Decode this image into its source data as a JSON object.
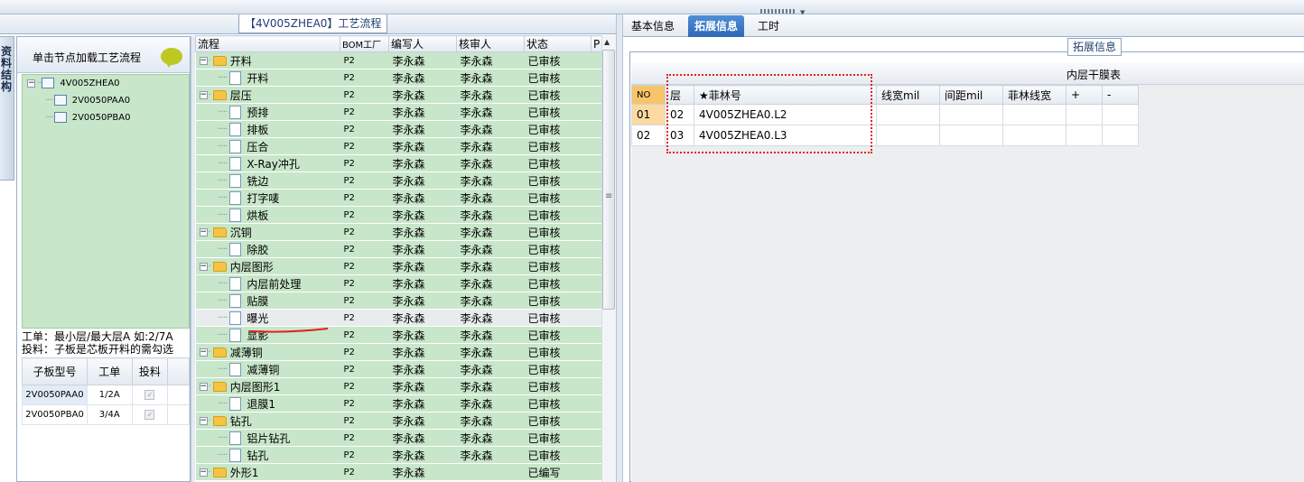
{
  "top": {
    "title": "【4V005ZHEA0】工艺流程"
  },
  "left": {
    "vertical_tab": "资料结构",
    "header_text": "单击节点加载工艺流程",
    "tree": [
      {
        "label": "4V005ZHEA0",
        "level": 0
      },
      {
        "label": "2V0050PAA0",
        "level": 1
      },
      {
        "label": "2V0050PBA0",
        "level": 1
      }
    ],
    "note_line1": "工单：最小层/最大层A 如:2/7A",
    "note_line2": "投料：子板是芯板开料的需勾选",
    "subgrid": {
      "headers": [
        "子板型号",
        "工单",
        "投料"
      ],
      "rows": [
        {
          "model": "2V0050PAA0",
          "order": "1/2A",
          "checked": true
        },
        {
          "model": "2V0050PBA0",
          "order": "3/4A",
          "checked": true
        }
      ]
    }
  },
  "process": {
    "headers": [
      "流程",
      "BOM工厂",
      "编写人",
      "核审人",
      "状态",
      "P"
    ],
    "rows": [
      {
        "name": "开料",
        "type": "folder",
        "bom": "P2",
        "writer": "李永森",
        "auditor": "李永森",
        "status": "已审核"
      },
      {
        "name": "开料",
        "type": "step",
        "bom": "P2",
        "writer": "李永森",
        "auditor": "李永森",
        "status": "已审核"
      },
      {
        "name": "层压",
        "type": "folder",
        "bom": "P2",
        "writer": "李永森",
        "auditor": "李永森",
        "status": "已审核"
      },
      {
        "name": "预排",
        "type": "step",
        "bom": "P2",
        "writer": "李永森",
        "auditor": "李永森",
        "status": "已审核"
      },
      {
        "name": "排板",
        "type": "step",
        "bom": "P2",
        "writer": "李永森",
        "auditor": "李永森",
        "status": "已审核"
      },
      {
        "name": "压合",
        "type": "step",
        "bom": "P2",
        "writer": "李永森",
        "auditor": "李永森",
        "status": "已审核"
      },
      {
        "name": "X-Ray冲孔",
        "type": "step",
        "bom": "P2",
        "writer": "李永森",
        "auditor": "李永森",
        "status": "已审核"
      },
      {
        "name": "铣边",
        "type": "step",
        "bom": "P2",
        "writer": "李永森",
        "auditor": "李永森",
        "status": "已审核"
      },
      {
        "name": "打字唛",
        "type": "step",
        "bom": "P2",
        "writer": "李永森",
        "auditor": "李永森",
        "status": "已审核"
      },
      {
        "name": "烘板",
        "type": "step",
        "bom": "P2",
        "writer": "李永森",
        "auditor": "李永森",
        "status": "已审核"
      },
      {
        "name": "沉铜",
        "type": "folder",
        "bom": "P2",
        "writer": "李永森",
        "auditor": "李永森",
        "status": "已审核"
      },
      {
        "name": "除胶",
        "type": "step",
        "bom": "P2",
        "writer": "李永森",
        "auditor": "李永森",
        "status": "已审核"
      },
      {
        "name": "内层图形",
        "type": "folder",
        "bom": "P2",
        "writer": "李永森",
        "auditor": "李永森",
        "status": "已审核"
      },
      {
        "name": "内层前处理",
        "type": "step",
        "bom": "P2",
        "writer": "李永森",
        "auditor": "李永森",
        "status": "已审核"
      },
      {
        "name": "贴膜",
        "type": "step",
        "bom": "P2",
        "writer": "李永森",
        "auditor": "李永森",
        "status": "已审核"
      },
      {
        "name": "曝光",
        "type": "step",
        "bom": "P2",
        "writer": "李永森",
        "auditor": "李永森",
        "status": "已审核",
        "selected": true
      },
      {
        "name": "显影",
        "type": "step",
        "bom": "P2",
        "writer": "李永森",
        "auditor": "李永森",
        "status": "已审核"
      },
      {
        "name": "减薄铜",
        "type": "folder",
        "bom": "P2",
        "writer": "李永森",
        "auditor": "李永森",
        "status": "已审核"
      },
      {
        "name": "减薄铜",
        "type": "step",
        "bom": "P2",
        "writer": "李永森",
        "auditor": "李永森",
        "status": "已审核"
      },
      {
        "name": "内层图形1",
        "type": "folder",
        "bom": "P2",
        "writer": "李永森",
        "auditor": "李永森",
        "status": "已审核"
      },
      {
        "name": "退膜1",
        "type": "step",
        "bom": "P2",
        "writer": "李永森",
        "auditor": "李永森",
        "status": "已审核"
      },
      {
        "name": "钻孔",
        "type": "folder",
        "bom": "P2",
        "writer": "李永森",
        "auditor": "李永森",
        "status": "已审核"
      },
      {
        "name": "铝片钻孔",
        "type": "step",
        "bom": "P2",
        "writer": "李永森",
        "auditor": "李永森",
        "status": "已审核"
      },
      {
        "name": "钻孔",
        "type": "step",
        "bom": "P2",
        "writer": "李永森",
        "auditor": "李永森",
        "status": "已审核"
      },
      {
        "name": "外形1",
        "type": "folder",
        "bom": "P2",
        "writer": "李永森",
        "auditor": "",
        "status": "已编写"
      }
    ]
  },
  "right": {
    "tabs": [
      "基本信息",
      "拓展信息",
      "工时"
    ],
    "active_tab": 1,
    "section_label": "拓展信息",
    "grid_caption": "内层干膜表",
    "grid": {
      "headers": [
        "NO",
        "层",
        "★菲林号",
        "线宽mil",
        "间距mil",
        "菲林线宽",
        "+",
        "-"
      ],
      "rows": [
        [
          "01",
          "02",
          "4V005ZHEA0.L2",
          "",
          "",
          "",
          "",
          ""
        ],
        [
          "02",
          "03",
          "4V005ZHEA0.L3",
          "",
          "",
          "",
          "",
          ""
        ]
      ]
    }
  },
  "colors": {
    "tree_bg": "#c8e6c9",
    "active_tab": "#2d68b7",
    "annotation_red": "#e02020"
  }
}
